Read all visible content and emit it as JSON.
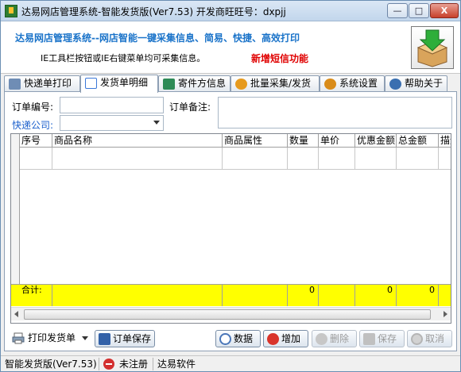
{
  "window": {
    "title": "达易网店管理系统-智能发货版(Ver7.53) 开发商旺旺号：dxpjj",
    "controls": {
      "minimize": "—",
      "maximize": "□",
      "close": "X"
    }
  },
  "banner": {
    "headline": "达易网店管理系统--网店智能一键采集信息、简易、快捷、高效打印",
    "note": "IE工具栏按钮或IE右键菜单均可采集信息。",
    "new_feature": "新增短信功能"
  },
  "tabs": [
    {
      "label": "快递单打印",
      "icon": "printer-icon",
      "color": "#4a6fa5"
    },
    {
      "label": "发货单明细",
      "icon": "document-icon",
      "color": "#3b78d8"
    },
    {
      "label": "寄件方信息",
      "icon": "contact-card-icon",
      "color": "#2e8b57"
    },
    {
      "label": "批量采集/发货",
      "icon": "orange-gear-icon",
      "color": "#e69a1e"
    },
    {
      "label": "系统设置",
      "icon": "settings-icon",
      "color": "#d98c1a"
    },
    {
      "label": "帮助关于",
      "icon": "help-icon",
      "color": "#3a6fb0"
    }
  ],
  "form": {
    "order_no_label": "订单编号:",
    "order_no_value": "",
    "remark_label": "订单备注:",
    "remark_value": "",
    "courier_label": "快递公司:",
    "courier_value": ""
  },
  "grid": {
    "columns": [
      "序号",
      "商品名称",
      "商品属性",
      "数量",
      "单价",
      "优惠金额",
      "总金额",
      "描述"
    ],
    "totals_label": "合计:",
    "totals": {
      "quantity": "0",
      "discount": "0",
      "total": "0"
    }
  },
  "buttons": {
    "print_invoice": "打印发货单",
    "save_order": "订单保存",
    "data": "数据",
    "add": "增加",
    "delete": "删除",
    "save": "保存",
    "cancel": "取消"
  },
  "statusbar": {
    "version": "智能发货版(Ver7.53)",
    "registration": "未注册",
    "vendor": "达易软件"
  }
}
